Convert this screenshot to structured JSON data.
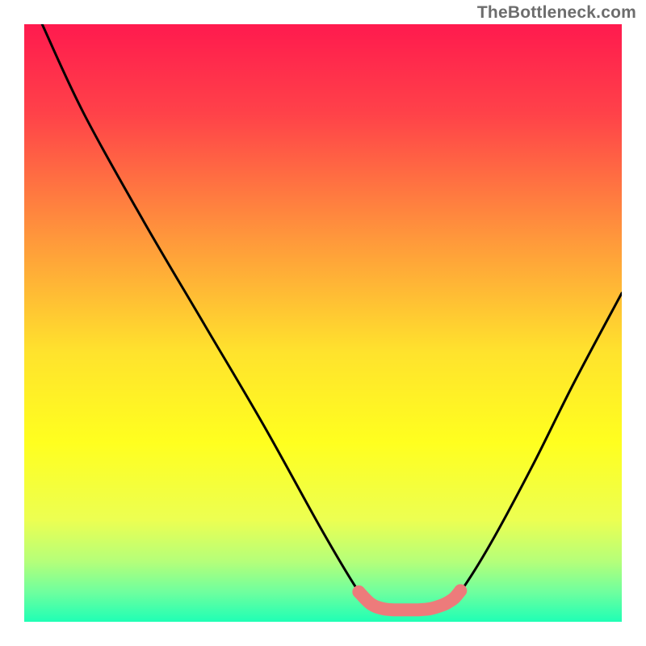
{
  "watermark": "TheBottleneck.com",
  "chart_data": {
    "type": "line",
    "title": "",
    "xlabel": "",
    "ylabel": "",
    "xlim": [
      0,
      1
    ],
    "ylim": [
      0,
      1
    ],
    "background_gradient": {
      "direction": "top-to-bottom",
      "stops": [
        {
          "pos": 0.0,
          "color": "#ff1a4e"
        },
        {
          "pos": 0.15,
          "color": "#ff4249"
        },
        {
          "pos": 0.35,
          "color": "#ff943c"
        },
        {
          "pos": 0.55,
          "color": "#ffe32d"
        },
        {
          "pos": 0.7,
          "color": "#ffff1f"
        },
        {
          "pos": 0.83,
          "color": "#ecff52"
        },
        {
          "pos": 0.9,
          "color": "#b4ff7a"
        },
        {
          "pos": 0.95,
          "color": "#6fff9e"
        },
        {
          "pos": 1.0,
          "color": "#1fffb5"
        }
      ]
    },
    "series": [
      {
        "name": "bottleneck-curve",
        "x": [
          0.03,
          0.1,
          0.2,
          0.3,
          0.4,
          0.5,
          0.56,
          0.58,
          0.63,
          0.68,
          0.71,
          0.73,
          0.78,
          0.85,
          0.92,
          1.0
        ],
        "y": [
          1.0,
          0.85,
          0.67,
          0.5,
          0.33,
          0.15,
          0.05,
          0.03,
          0.02,
          0.02,
          0.03,
          0.05,
          0.13,
          0.26,
          0.4,
          0.55
        ]
      }
    ],
    "annotations": [
      {
        "name": "sweet-spot-highlight",
        "type": "segment",
        "color": "#ed7b7b",
        "x": [
          0.56,
          0.58,
          0.6,
          0.62,
          0.64,
          0.66,
          0.68,
          0.7,
          0.71,
          0.72,
          0.73
        ],
        "y": [
          0.05,
          0.03,
          0.022,
          0.02,
          0.02,
          0.02,
          0.022,
          0.028,
          0.033,
          0.04,
          0.052
        ]
      }
    ]
  }
}
